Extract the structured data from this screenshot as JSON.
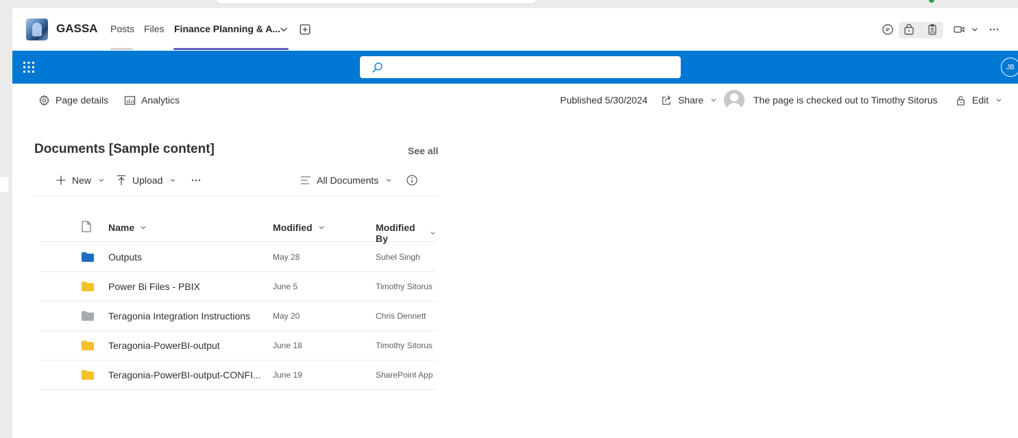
{
  "team": {
    "name": "GASSA",
    "tabs": [
      {
        "label": "Posts"
      },
      {
        "label": "Files"
      },
      {
        "label": "Finance Planning & A..."
      }
    ]
  },
  "suite": {
    "search_placeholder": "",
    "avatar_initials": "JB",
    "accent_color": "#0078d4"
  },
  "page_commands": {
    "page_details": "Page details",
    "analytics": "Analytics",
    "published": "Published 5/30/2024",
    "share": "Share",
    "checked_out": "The page is checked out to Timothy Sitorus",
    "edit": "Edit"
  },
  "documents": {
    "title": "Documents [Sample content]",
    "see_all": "See all",
    "commands": {
      "new": "New",
      "upload": "Upload",
      "view": "All Documents"
    },
    "columns": {
      "name": "Name",
      "modified": "Modified",
      "modified_by": "Modified By"
    },
    "rows": [
      {
        "name": "Outputs",
        "modified": "May 28",
        "modified_by": "Suhel Singh",
        "folder_color": "#1b6ec2"
      },
      {
        "name": "Power Bi Files - PBIX",
        "modified": "June 5",
        "modified_by": "Timothy Sitorus",
        "folder_color": "#f5c028"
      },
      {
        "name": "Teragonia Integration Instructions",
        "modified": "May 20",
        "modified_by": "Chris Dennett",
        "folder_color": "#a7abaf"
      },
      {
        "name": "Teragonia-PowerBI-output",
        "modified": "June 18",
        "modified_by": "Timothy Sitorus",
        "folder_color": "#f5c028"
      },
      {
        "name": "Teragonia-PowerBI-output-CONFI...",
        "modified": "June 19",
        "modified_by": "SharePoint App",
        "folder_color": "#f5c028"
      }
    ]
  }
}
